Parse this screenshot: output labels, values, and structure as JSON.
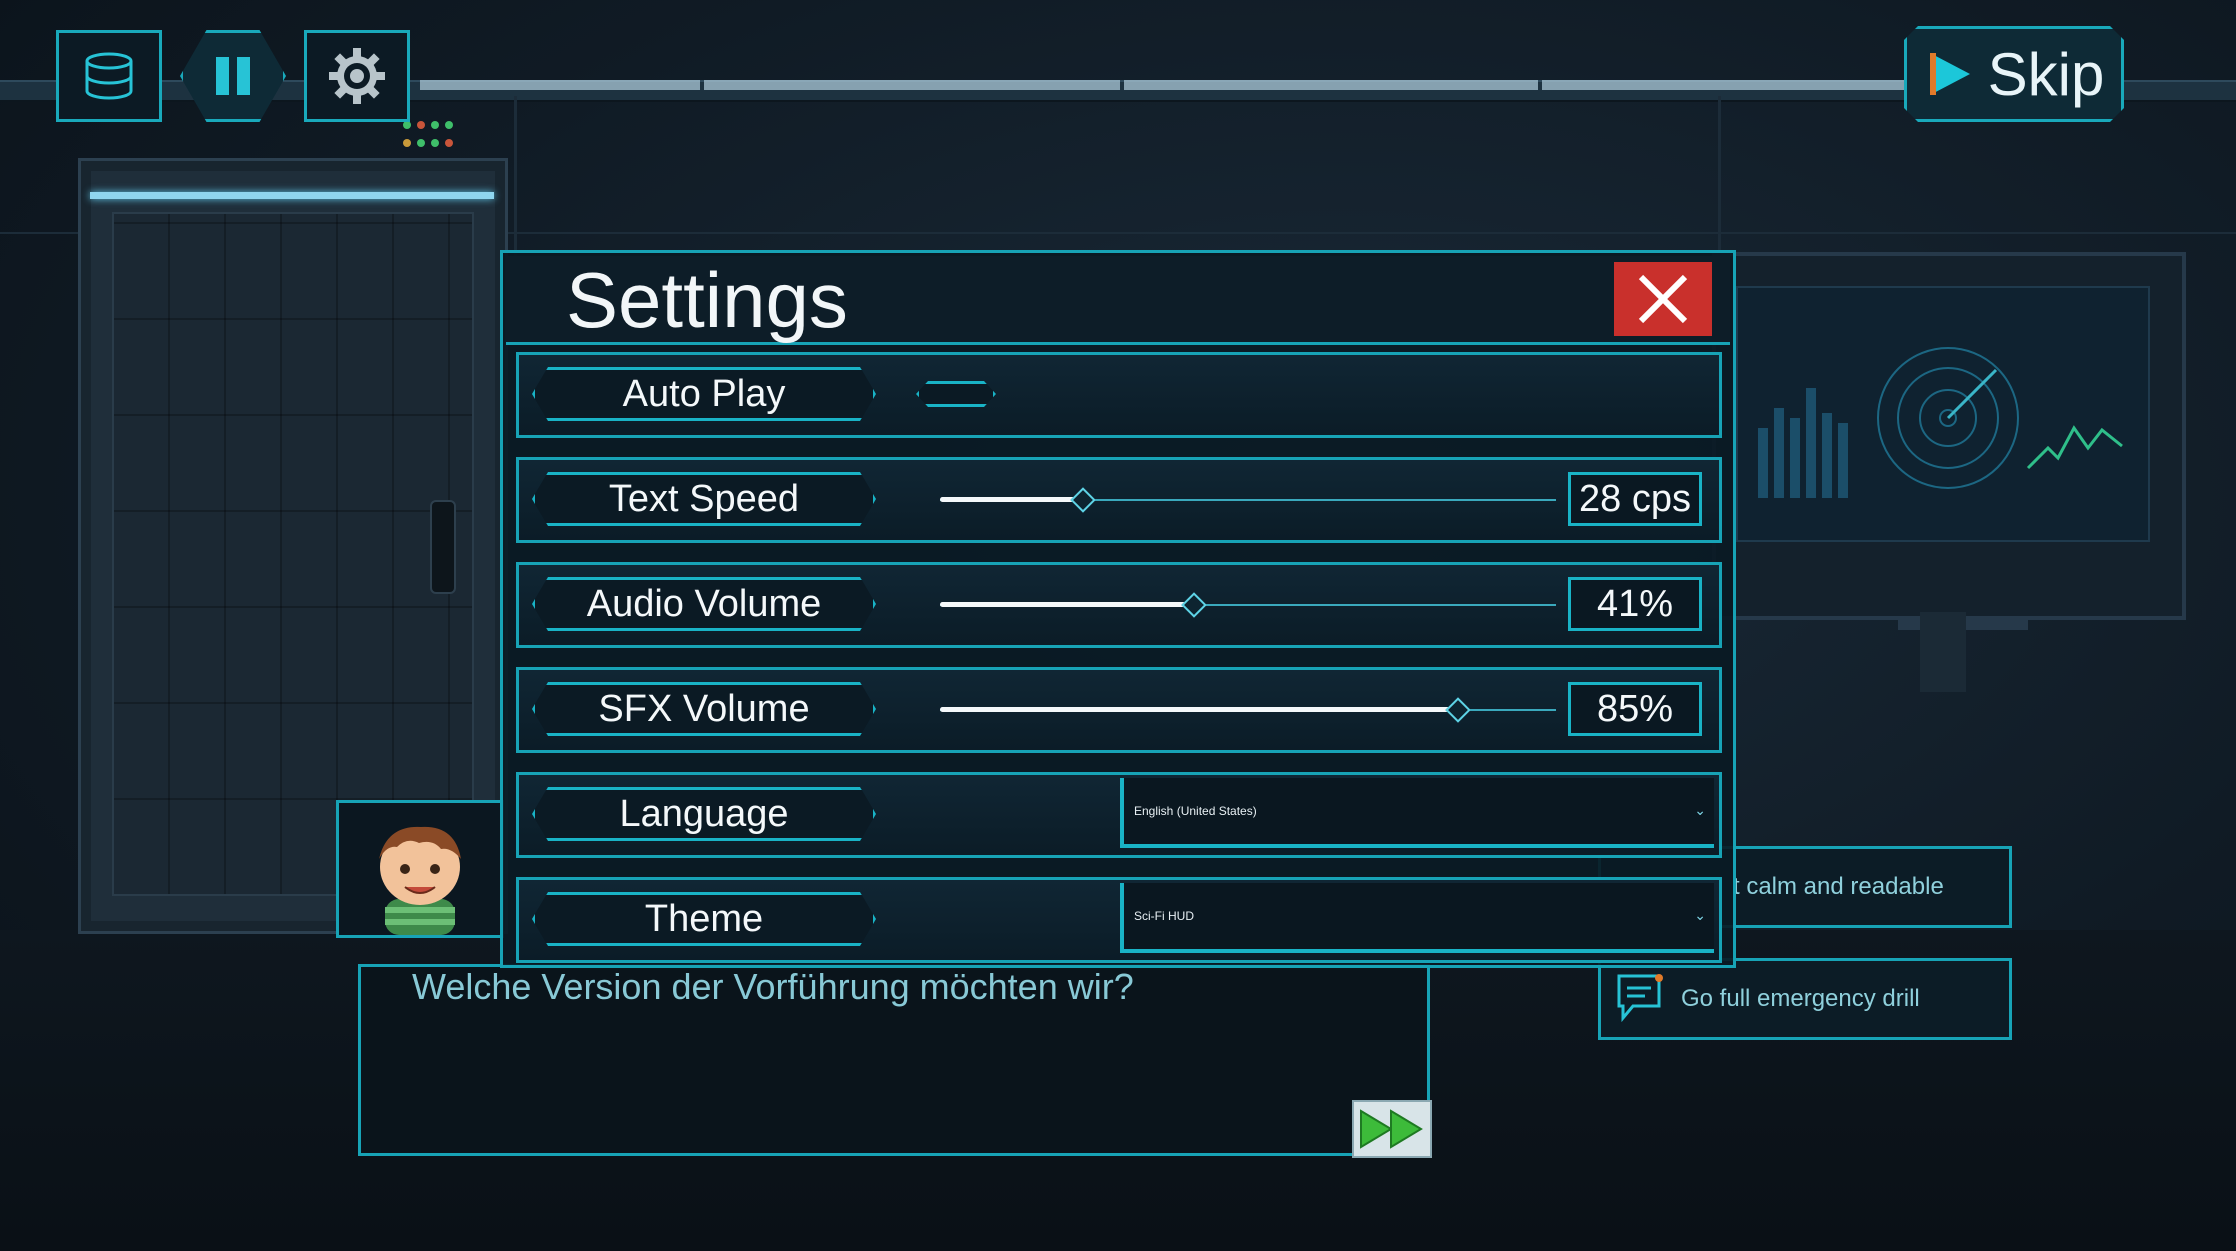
{
  "hud": {
    "buttons": [
      {
        "name": "database-icon"
      },
      {
        "name": "pause-icon"
      },
      {
        "name": "gear-icon"
      }
    ],
    "skip_label": "Skip"
  },
  "settings": {
    "title": "Settings",
    "close_icon": "close-icon",
    "rows": [
      {
        "label": "Auto Play",
        "control": "toggle",
        "value": false
      },
      {
        "label": "Text Speed",
        "control": "slider",
        "fraction": 0.23,
        "display": "28 cps"
      },
      {
        "label": "Audio Volume",
        "control": "slider",
        "fraction": 0.41,
        "display": "41%"
      },
      {
        "label": "SFX Volume",
        "control": "slider",
        "fraction": 0.84,
        "display": "85%"
      },
      {
        "label": "Language",
        "control": "dropdown",
        "selected": "English (United States)"
      },
      {
        "label": "Theme",
        "control": "dropdown",
        "selected": "Sci-Fi HUD"
      }
    ]
  },
  "dialogue": {
    "text": "Welche Version der Vorführung möchten wir?",
    "next_icon": "fast-forward-icon"
  },
  "choices": [
    {
      "label": "t calm and readable",
      "icon": ""
    },
    {
      "label": "Go full emergency drill",
      "icon": "chat-bubble-icon"
    }
  ],
  "colors": {
    "accent": "#17a3b6",
    "close": "#c9302c",
    "skip_arrow": "#1cc7d9"
  }
}
